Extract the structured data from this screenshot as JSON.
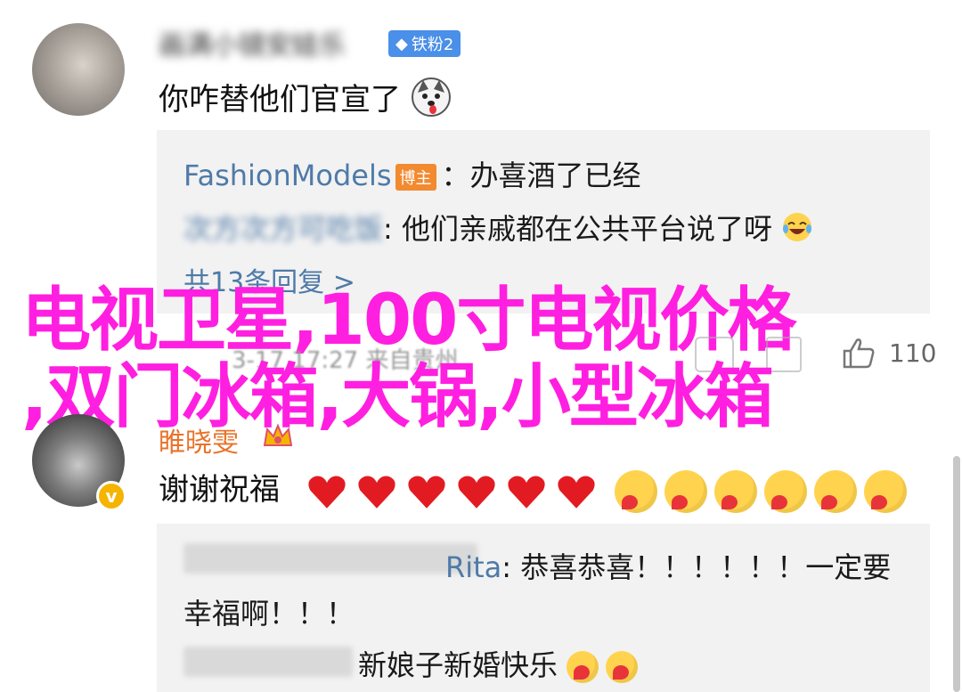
{
  "comments": [
    {
      "username_blurred": "画满小镜安娃乐",
      "badge": "铁粉2",
      "text": "你咋替他们官宣了",
      "emoji_icon": "husky-dog-emoji",
      "replies": [
        {
          "name": "FashionModels",
          "tag": "博主",
          "text": "：办喜酒了已经"
        },
        {
          "name": "次方次方可吃饭",
          "text": ": 他们亲戚都在公共平台说了呀"
        }
      ],
      "more_replies": "共13条回复 >",
      "meta": "3-17 17:27 来自贵州",
      "likes": "110"
    },
    {
      "username": "睢晓雯",
      "verified_icon": "v",
      "text": "谢谢祝福",
      "replies": [
        {
          "name": "Rita",
          "text": ": 恭喜恭喜！！！！！！一定要"
        },
        {
          "continuation": "幸福啊！！！"
        },
        {
          "text": "新娘子新婚快乐"
        }
      ]
    }
  ],
  "overlay": {
    "line1": "电视卫星,100寸电视价格",
    "line2": ",双门冰箱,大锅,小型冰箱",
    "color": "#ff1fe0"
  },
  "colors": {
    "link": "#4f7aa8",
    "reply_bg": "#f2f2f2",
    "badge_blue": "#4a8fe8",
    "badge_orange": "#f28a30"
  }
}
